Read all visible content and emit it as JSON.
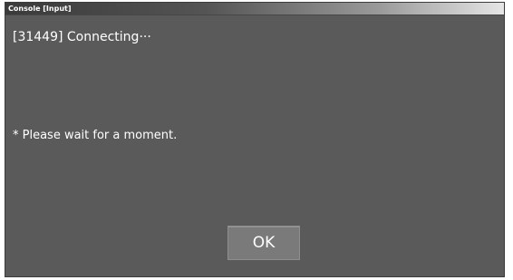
{
  "window": {
    "title": "Console [Input]"
  },
  "console": {
    "status_text": "[31449] Connecting···",
    "wait_message": "* Please wait for a moment."
  },
  "dialog": {
    "ok_label": "OK"
  },
  "colors": {
    "background": "#5a5a5a",
    "text": "#ffffff",
    "button": "#7a7a7a"
  }
}
